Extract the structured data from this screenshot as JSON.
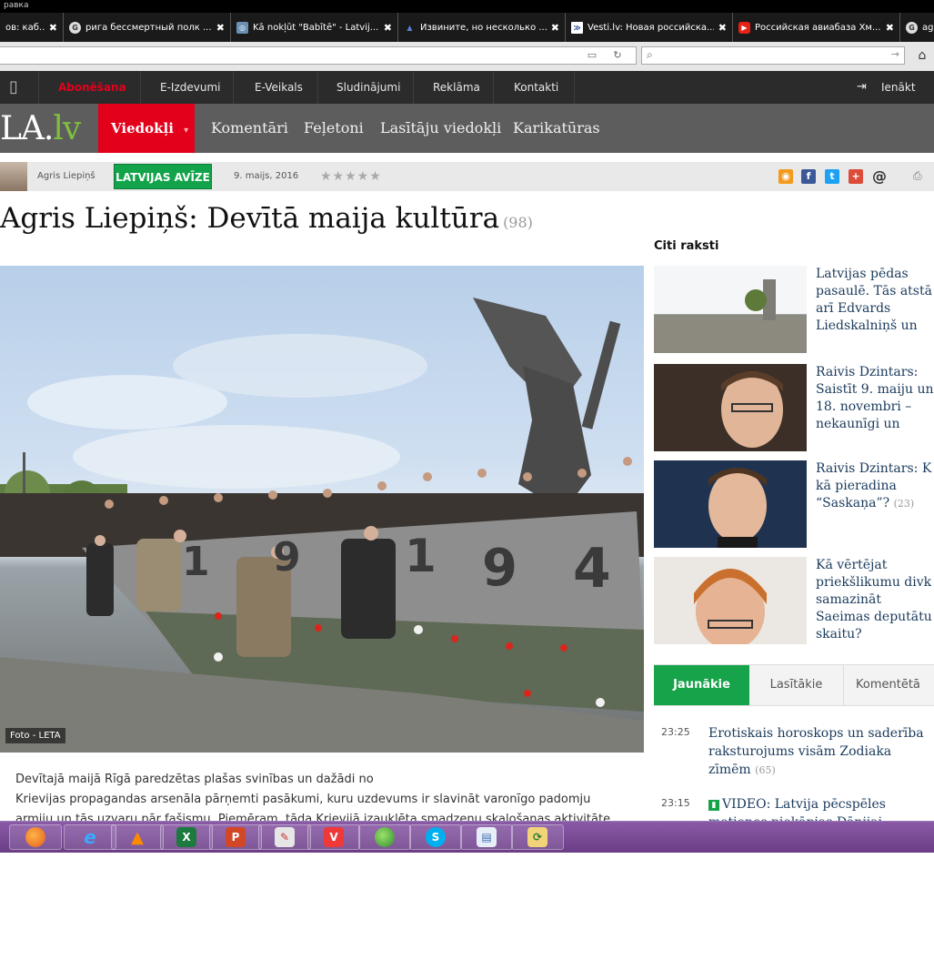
{
  "window": {
    "title": "равка"
  },
  "browser": {
    "tabs": [
      {
        "label": "ов: каб...",
        "icon": "generic-page-icon"
      },
      {
        "label": "рига бессмертный полк ...",
        "icon": "google-icon"
      },
      {
        "label": "Kā nokļūt \"Babītē\" - Latvij...",
        "icon": "globe-icon"
      },
      {
        "label": "Извините, но несколько ...",
        "icon": "user-icon"
      },
      {
        "label": "Vesti.lv: Новая российска...",
        "icon": "vesti-icon"
      },
      {
        "label": "Российская авиабаза Хм...",
        "icon": "youtube-icon"
      },
      {
        "label": "agr",
        "icon": "google-icon"
      }
    ],
    "close_glyph": "✖"
  },
  "site": {
    "topnav": {
      "subscribe": "Abonēšana",
      "items": [
        "E-Izdevumi",
        "E-Veikals",
        "Sludinājumi",
        "Reklāma",
        "Kontakti"
      ],
      "login": "Ienākt"
    },
    "logo": {
      "main": "LA.",
      "suffix": "lv"
    },
    "sections": {
      "active": "Viedokļi",
      "items": [
        "Komentāri",
        "Feļetoni",
        "Lasītāju viedokļi",
        "Karikatūras"
      ]
    },
    "meta": {
      "author": "Agris Liepiņš",
      "paper": "LATVIJAS AVĪZE",
      "date": "9. maijs, 2016",
      "stars": "★★★★★"
    },
    "article": {
      "title": "Agris Liepiņš: Devītā maija kultūra",
      "comments": "(98)",
      "photo_credit": "Foto - LETA",
      "photo_numbers": [
        "1",
        "9",
        "1",
        "9",
        "4"
      ],
      "lead_lines": [
        "Devītajā maijā Rīgā paredzētas plašas svinības un dažādi no",
        "Krievijas propagandas arsenāla pārņemti pasākumi, kuru uzdevums ir slavināt varonīgo padomju",
        "armiju un tās uzvaru pār fašismu. Piemēram, tāda Krievijā izaukļēta smadzeņu skalošanas aktivitāte"
      ]
    },
    "sidebar": {
      "title": "Citi raksti",
      "cards": [
        {
          "text": "Latvijas pēdas pasaulē. Tās atstā arī Edvards Liedskalniņš un",
          "count": ""
        },
        {
          "text": "Raivis Dzintars: Saistīt 9. maiju un 18. novembri – nekaunīgi un",
          "count": ""
        },
        {
          "text": "Raivis Dzintars: K kā pieradina “Saskaņa”?",
          "count": "(23)"
        },
        {
          "text": "Kā vērtējat priekšlikumu divk samazināt Saeimas deputātu skaitu?",
          "count": ""
        }
      ],
      "tabs": [
        "Jaunākie",
        "Lasītākie",
        "Komentētā"
      ],
      "news": [
        {
          "time": "23:25",
          "text": "Erotiskais horoskops un saderība raksturojums visām Zodiaka zīmēm",
          "count": "(65)",
          "video": false
        },
        {
          "time": "23:15",
          "text": "VIDEO: Latvija pēcspēles metienos piekāpjas Dānijai",
          "count": "",
          "video": true
        }
      ]
    }
  },
  "colors": {
    "brand_red": "#e3001b",
    "brand_green": "#16a34a",
    "nav_dark": "#2b2b2b",
    "link_blue": "#1a3a5c"
  }
}
